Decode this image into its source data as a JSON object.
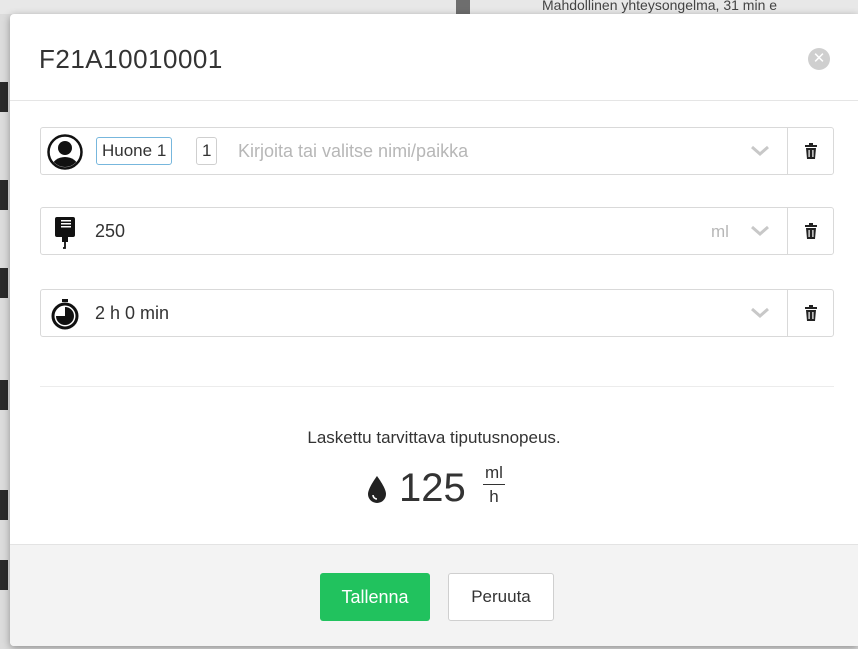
{
  "background": {
    "notice_text": "Mahdollinen yhteysongelma, 31 min e"
  },
  "dialog": {
    "title": "F21A10010001",
    "close_icon": "close-circle-icon"
  },
  "patient_field": {
    "icon": "user-avatar-icon",
    "room_tag": "Huone 1",
    "bed_tag": "1",
    "placeholder": "Kirjoita tai valitse nimi/paikka"
  },
  "volume_field": {
    "icon": "iv-bag-icon",
    "value": "250",
    "unit": "ml"
  },
  "duration_field": {
    "icon": "timer-icon",
    "value": "2 h 0 min"
  },
  "result": {
    "label": "Laskettu tarvittava tiputusnopeus.",
    "icon": "drop-icon",
    "value": "125",
    "unit_numerator": "ml",
    "unit_denominator": "h"
  },
  "footer": {
    "save_label": "Tallenna",
    "cancel_label": "Peruuta"
  },
  "colors": {
    "save_button": "#21c25e",
    "room_tag_border": "#77b7dd",
    "placeholder": "#b7b7b7"
  }
}
